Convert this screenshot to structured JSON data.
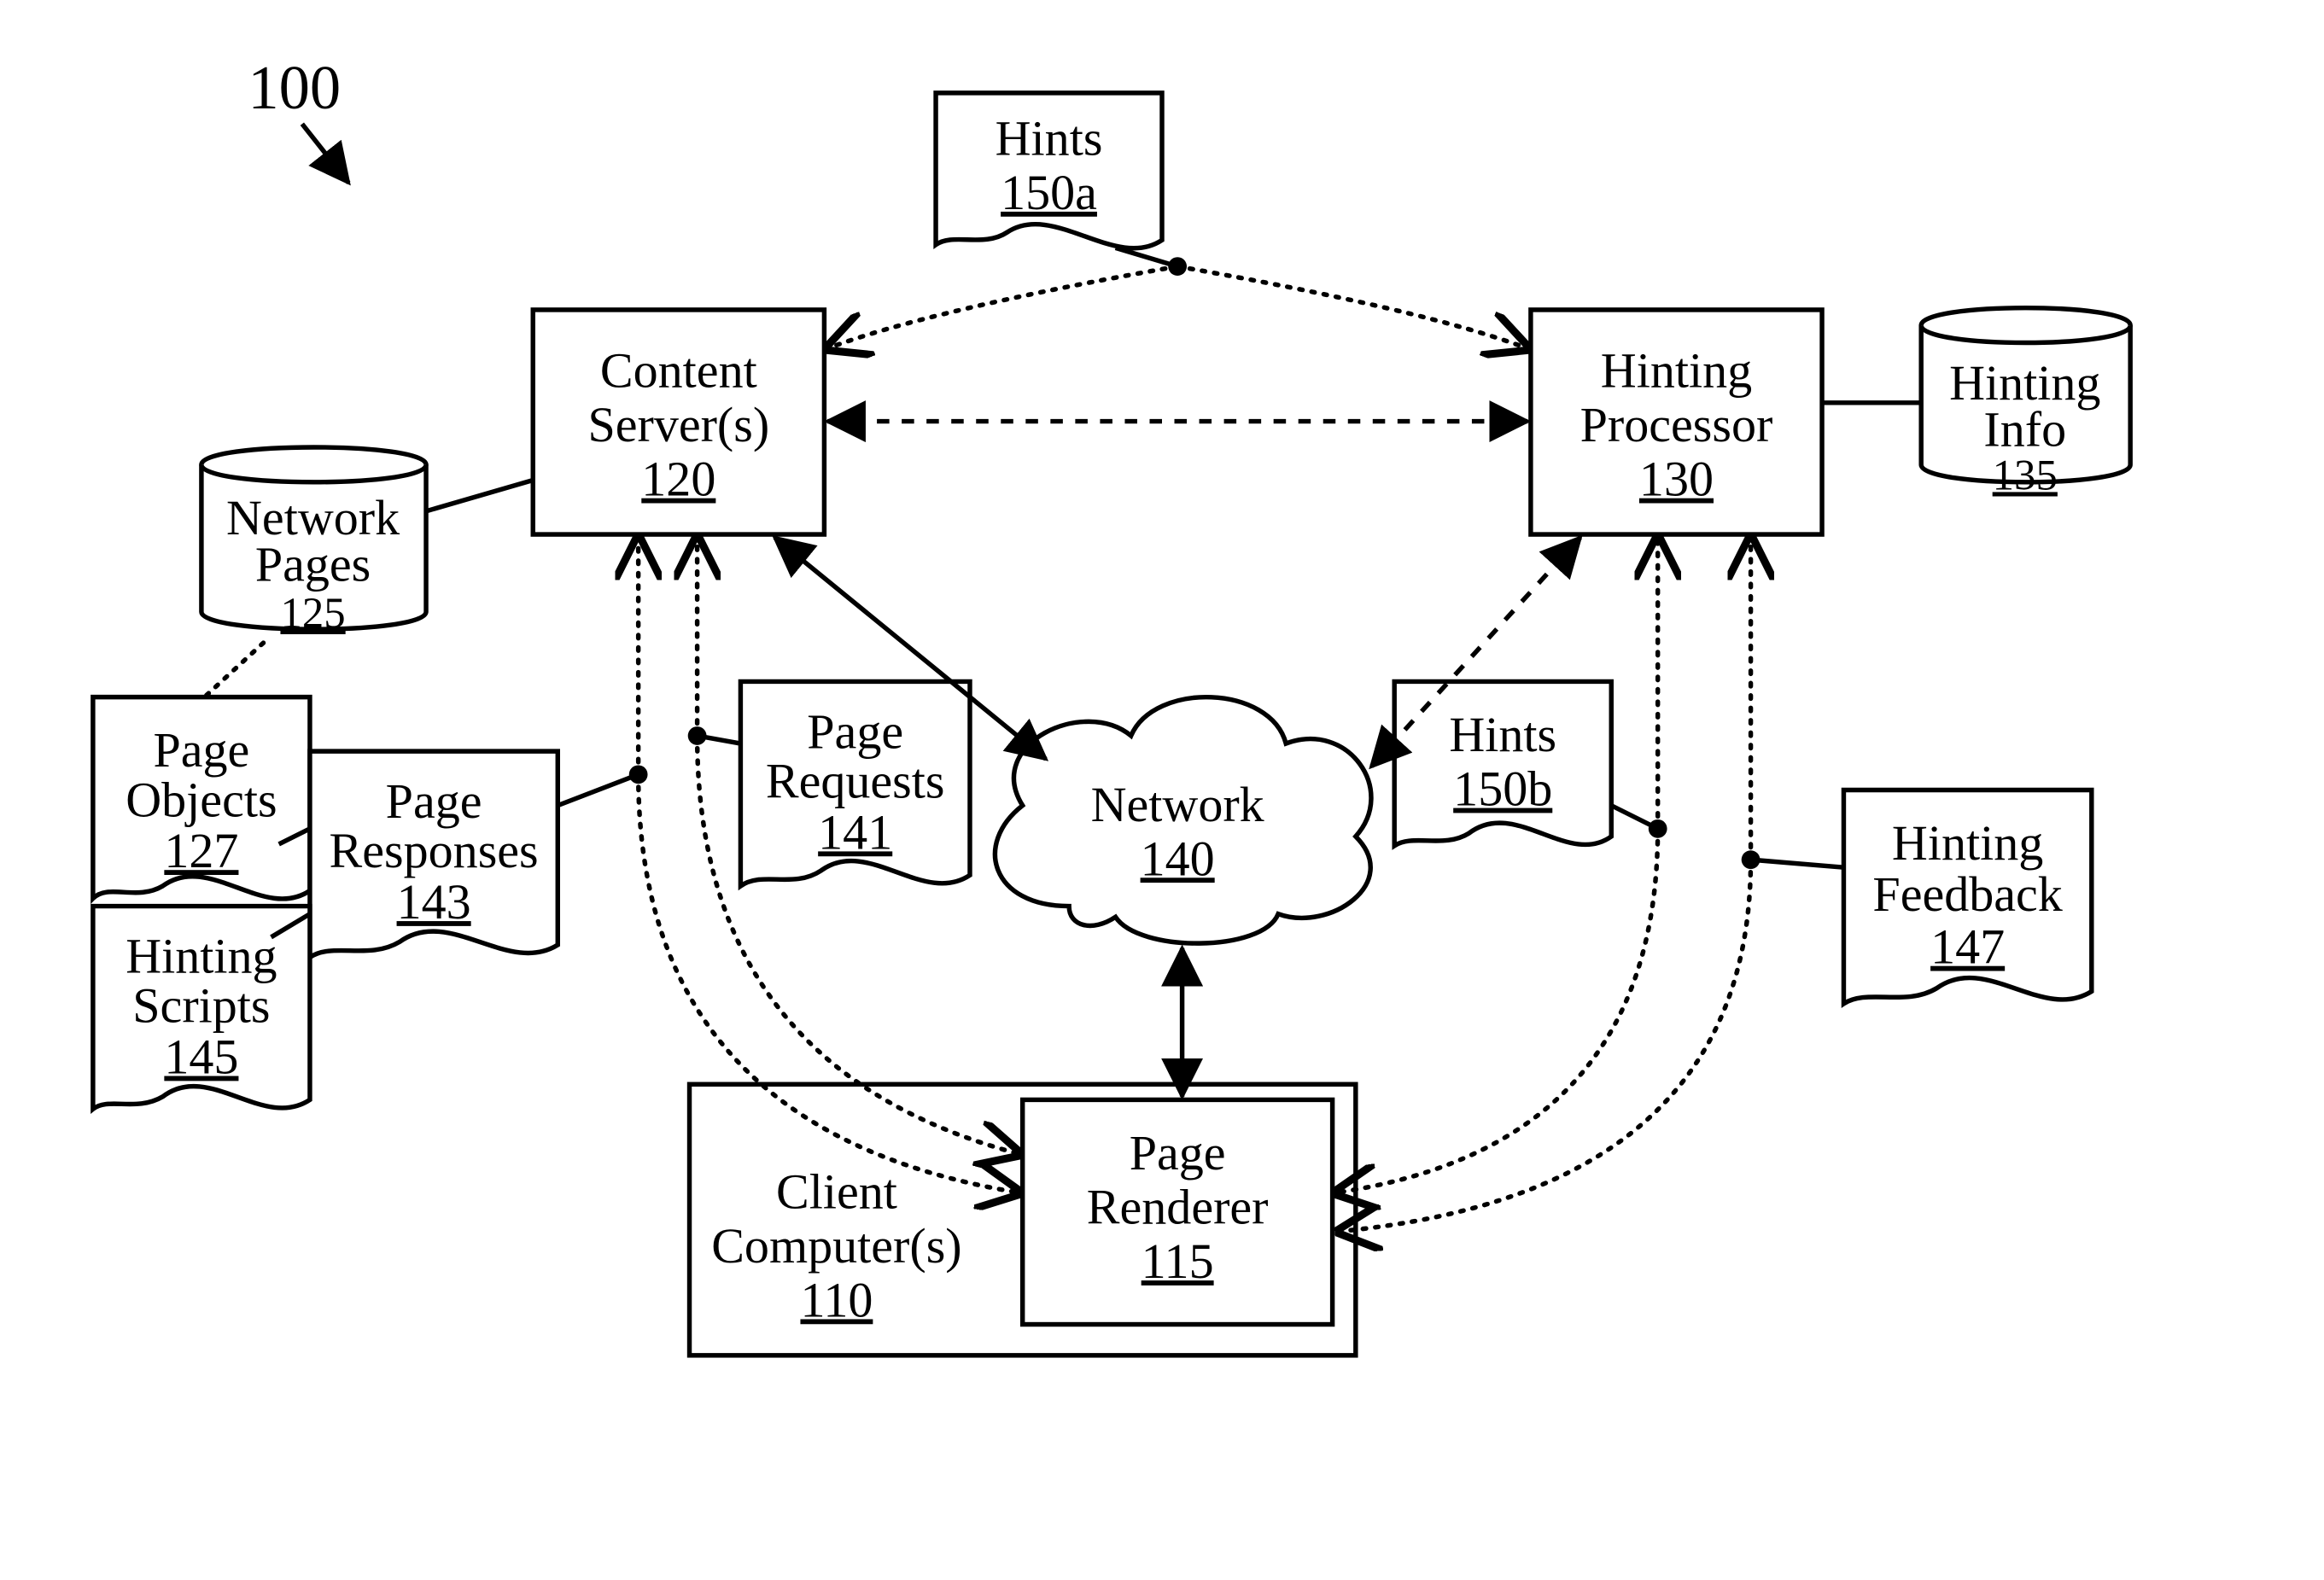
{
  "figure_label": "100",
  "nodes": {
    "content_servers": {
      "line1": "Content",
      "line2": "Server(s)",
      "ref": "120"
    },
    "hinting_processor": {
      "line1": "Hinting",
      "line2": "Processor",
      "ref": "130"
    },
    "network_pages": {
      "line1": "Network",
      "line2": "Pages",
      "ref": "125"
    },
    "hinting_info": {
      "line1": "Hinting",
      "line2": "Info",
      "ref": "135"
    },
    "network": {
      "line1": "Network",
      "ref": "140"
    },
    "client_computers": {
      "line1": "Client",
      "line2": "Computer(s)",
      "ref": "110"
    },
    "page_renderer": {
      "line1": "Page",
      "line2": "Renderer",
      "ref": "115"
    },
    "hints_a": {
      "line1": "Hints",
      "ref": "150a"
    },
    "hints_b": {
      "line1": "Hints",
      "ref": "150b"
    },
    "page_objects": {
      "line1": "Page",
      "line2": "Objects",
      "ref": "127"
    },
    "page_responses": {
      "line1": "Page",
      "line2": "Responses",
      "ref": "143"
    },
    "page_requests": {
      "line1": "Page",
      "line2": "Requests",
      "ref": "141"
    },
    "hinting_scripts": {
      "line1": "Hinting",
      "line2": "Scripts",
      "ref": "145"
    },
    "hinting_feedback": {
      "line1": "Hinting",
      "line2": "Feedback",
      "ref": "147"
    }
  }
}
